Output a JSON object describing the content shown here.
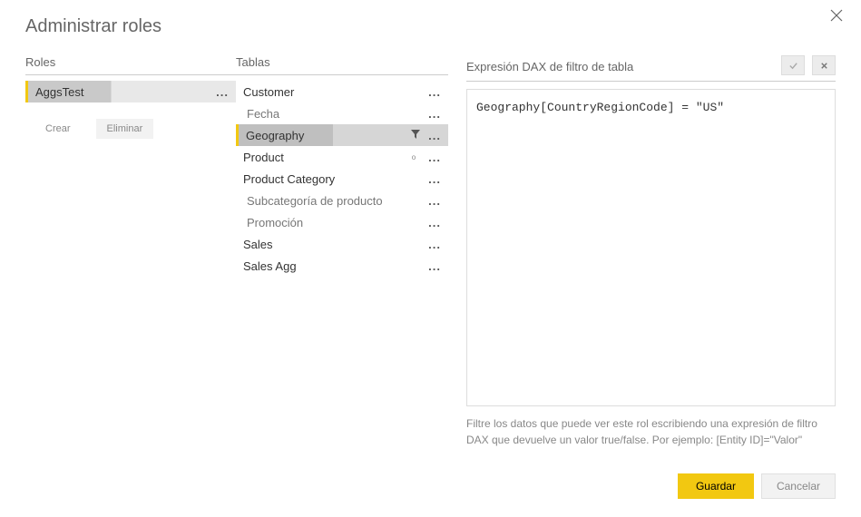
{
  "dialog": {
    "title": "Administrar roles"
  },
  "roles": {
    "header": "Roles",
    "items": [
      {
        "label": "AggsTest",
        "selected": true
      }
    ],
    "create_label": "Crear",
    "delete_label": "Eliminar"
  },
  "tables": {
    "header": "Tablas",
    "items": [
      {
        "label": "Customer",
        "indent": 0,
        "selected": false,
        "filtered": false,
        "mark": ""
      },
      {
        "label": "Fecha",
        "indent": 1,
        "selected": false,
        "filtered": false,
        "mark": ""
      },
      {
        "label": "Geography",
        "indent": 0,
        "selected": true,
        "filtered": true,
        "mark": ""
      },
      {
        "label": "Product",
        "indent": 0,
        "selected": false,
        "filtered": false,
        "mark": "o"
      },
      {
        "label": "Product Category",
        "indent": 0,
        "selected": false,
        "filtered": false,
        "mark": ""
      },
      {
        "label": "Subcategoría de producto",
        "indent": 1,
        "selected": false,
        "filtered": false,
        "mark": ""
      },
      {
        "label": "Promoción",
        "indent": 1,
        "selected": false,
        "filtered": false,
        "mark": ""
      },
      {
        "label": "Sales",
        "indent": 0,
        "selected": false,
        "filtered": false,
        "mark": ""
      },
      {
        "label": "Sales Agg",
        "indent": 0,
        "selected": false,
        "filtered": false,
        "mark": ""
      }
    ]
  },
  "dax": {
    "header": "Expresión DAX de filtro de tabla",
    "expression": "Geography[CountryRegionCode] = \"US\"",
    "help": "Filtre los datos que puede ver este rol escribiendo una expresión de filtro DAX que devuelve un valor true/false. Por ejemplo: [Entity ID]=\"Valor\""
  },
  "footer": {
    "save_label": "Guardar",
    "cancel_label": "Cancelar"
  }
}
